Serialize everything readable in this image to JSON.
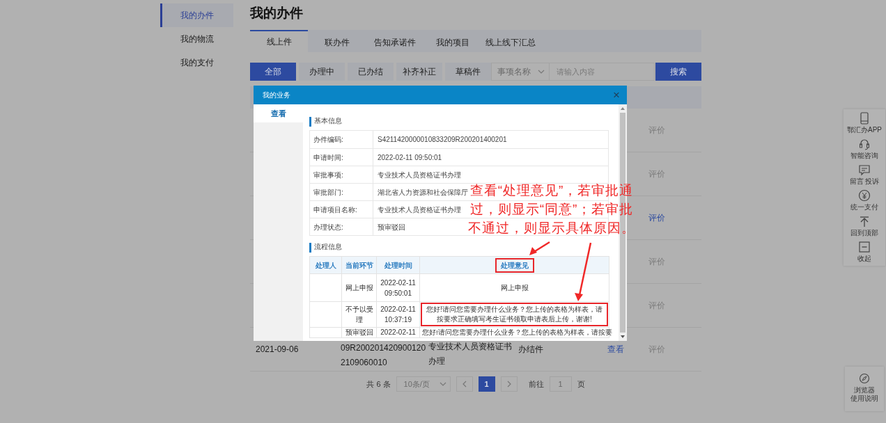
{
  "sidebar": {
    "items": [
      {
        "label": "我的办件",
        "selected": true
      },
      {
        "label": "我的物流",
        "selected": false
      },
      {
        "label": "我的支付",
        "selected": false
      }
    ]
  },
  "page_title": "我的办件",
  "tabs": [
    {
      "label": "线上件",
      "selected": true
    },
    {
      "label": "联办件",
      "selected": false
    },
    {
      "label": "告知承诺件",
      "selected": false
    },
    {
      "label": "我的项目",
      "selected": false
    },
    {
      "label": "线上线下汇总",
      "selected": false
    }
  ],
  "filters": [
    {
      "label": "全部",
      "selected": true
    },
    {
      "label": "办理中",
      "selected": false
    },
    {
      "label": "已办结",
      "selected": false
    },
    {
      "label": "补齐补正",
      "selected": false
    },
    {
      "label": "草稿件",
      "selected": false
    }
  ],
  "search": {
    "field_select": "事项名称",
    "placeholder": "请输入内容",
    "button": "搜索"
  },
  "table": {
    "rows": [
      {
        "evaluate": "评价",
        "evaluate_enabled": false
      },
      {
        "evaluate": "评价",
        "evaluate_enabled": false
      },
      {
        "evaluate": "评价",
        "evaluate_enabled": true
      },
      {
        "evaluate": "评价",
        "evaluate_enabled": false
      },
      {
        "evaluate": "评价",
        "evaluate_enabled": false
      },
      {
        "date": "2021-09-06",
        "code_lines": [
          "09R200201420900120",
          "2109060010"
        ],
        "item_lines": [
          "专业技术人员资格证书",
          "办理"
        ],
        "status": "办结件",
        "action": "查看",
        "evaluate": "评价",
        "evaluate_enabled": false
      }
    ]
  },
  "pagination": {
    "total": "共 6 条",
    "page_size": "10条/页",
    "pages": [
      {
        "label": "1",
        "selected": true
      }
    ],
    "goto_label": "前往",
    "goto_value": "1",
    "goto_suffix": "页"
  },
  "float_toolbar": {
    "items": [
      {
        "kind": "phone",
        "label": "鄂汇办APP"
      },
      {
        "kind": "headset",
        "label": "智能咨询"
      },
      {
        "kind": "chat",
        "label": "留言 投诉"
      },
      {
        "kind": "yen",
        "label": "统一支付"
      },
      {
        "kind": "top",
        "label": "回到顶部"
      },
      {
        "kind": "collapse",
        "label": "收起"
      }
    ]
  },
  "help_box": {
    "label_lines": [
      "浏览器",
      "使用说明"
    ]
  },
  "modal": {
    "title": "我的业务",
    "close": "×",
    "nav": [
      {
        "label": "查看",
        "selected": true
      }
    ],
    "basic_info": {
      "title": "基本信息",
      "rows": [
        {
          "label": "办件编码:",
          "value": "S4211420000010833209R200201400201"
        },
        {
          "label": "申请时间:",
          "value": "2022-02-11 09:50:01"
        },
        {
          "label": "审批事项:",
          "value": "专业技术人员资格证书办理"
        },
        {
          "label": "审批部门:",
          "value": "湖北省人力资源和社会保障厅"
        },
        {
          "label": "申请项目名称:",
          "value": "专业技术人员资格证书办理"
        },
        {
          "label": "办理状态:",
          "value": "预审驳回"
        }
      ]
    },
    "process": {
      "title": "流程信息",
      "columns": [
        {
          "label": "处理人",
          "highlighted": false
        },
        {
          "label": "当前环节",
          "highlighted": false
        },
        {
          "label": "处理时间",
          "highlighted": false
        },
        {
          "label": "处理意见",
          "highlighted": true
        }
      ],
      "rows": [
        {
          "stage": "网上申报",
          "time": "2022-02-11 09:50:01",
          "opinion": "网上申报",
          "highlighted": false
        },
        {
          "stage": "不予以受理",
          "time": "2022-02-11 10:37:19",
          "opinion": "您好!请问您需要办理什么业务？您上传的表格为样表，请按要求正确填写考生证书领取申请表后上传，谢谢!",
          "highlighted": true
        },
        {
          "stage": "预审驳回",
          "time": "2022-02-11",
          "opinion": "您好!请问您需要办理什么业务？您上传的表格为样表，请按要",
          "highlighted": false
        }
      ]
    }
  },
  "annotation": {
    "text": "查看“处理意见”，若审批通过，则显示“同意”；若审批不通过，则显示具体原因。"
  }
}
